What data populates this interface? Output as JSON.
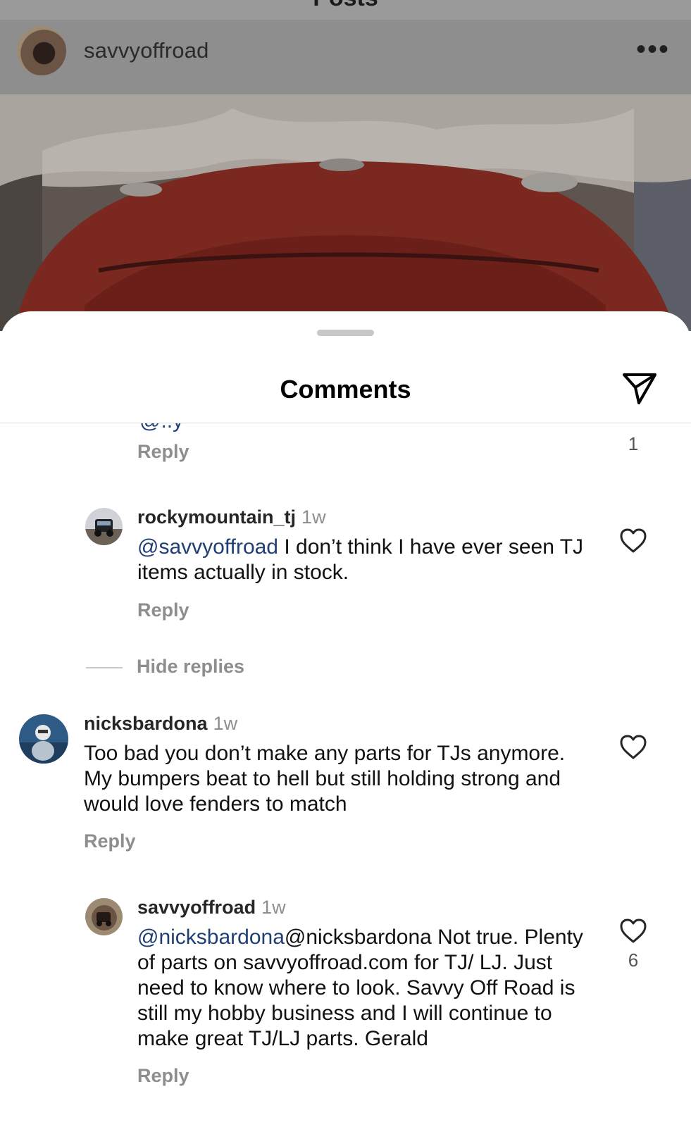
{
  "page": {
    "top_title": "Posts"
  },
  "post": {
    "username": "savvyoffroad",
    "more_icon": "more-horizontal-icon"
  },
  "sheet": {
    "title": "Comments",
    "share_icon": "paper-plane-icon"
  },
  "comments": {
    "partial": {
      "cut_text": "@..y",
      "reply_label": "Reply",
      "likes": "1"
    },
    "rocky": {
      "username": "rockymountain_tj",
      "time": "1w",
      "mention": "@savvyoffroad",
      "text": " I don’t think I have ever seen TJ items actually in stock.",
      "reply_label": "Reply"
    },
    "hide_replies_label": "Hide replies",
    "nick": {
      "username": "nicksbardona",
      "time": "1w",
      "text": "Too bad you don’t make any parts for TJs anymore. My bumpers beat to hell but still holding strong and would love fenders to match",
      "reply_label": "Reply"
    },
    "savvy": {
      "username": "savvyoffroad",
      "time": "1w",
      "mention": "@nicksbardona",
      "text": "@nicksbardona Not true. Plenty of parts on savvyoffroad.com for TJ/ LJ. Just need to know where to look. Savvy Off Road is still my hobby business and I will continue to make great TJ/LJ parts. Gerald",
      "reply_label": "Reply",
      "likes": "6"
    }
  },
  "colors": {
    "mention": "#1f3f73",
    "secondary_text": "#8e8e8e",
    "divider": "#dbdbdb"
  }
}
